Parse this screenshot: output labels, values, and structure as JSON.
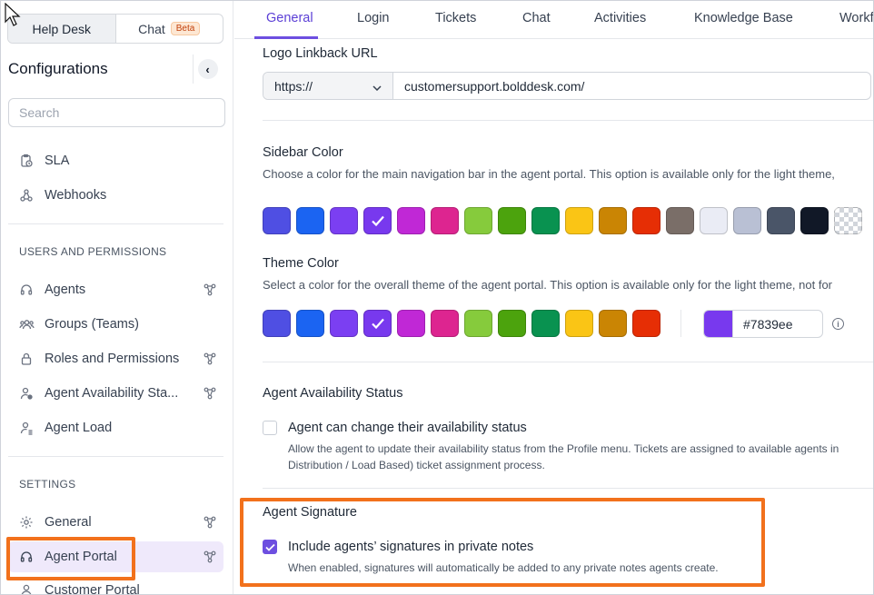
{
  "product_switch": {
    "helpdesk": "Help Desk",
    "chat": "Chat",
    "beta": "Beta"
  },
  "sidebar": {
    "title": "Configurations",
    "search_placeholder": "Search",
    "top_items": [
      {
        "label": "SLA",
        "icon": "clipboard-clock-icon"
      },
      {
        "label": "Webhooks",
        "icon": "webhook-icon"
      }
    ],
    "section_users": "USERS AND PERMISSIONS",
    "user_items": [
      {
        "label": "Agents",
        "icon": "headset-icon"
      },
      {
        "label": "Groups (Teams)",
        "icon": "users-icon"
      },
      {
        "label": "Roles and Permissions",
        "icon": "lock-icon"
      },
      {
        "label": "Agent Availability Sta...",
        "icon": "user-status-icon"
      },
      {
        "label": "Agent Load",
        "icon": "user-load-icon"
      }
    ],
    "section_settings": "SETTINGS",
    "settings_items": [
      {
        "label": "General",
        "icon": "gear-icon"
      },
      {
        "label": "Agent Portal",
        "icon": "headset-icon"
      },
      {
        "label": "Customer Portal",
        "icon": "user-icon"
      }
    ]
  },
  "tabs": [
    "General",
    "Login",
    "Tickets",
    "Chat",
    "Activities",
    "Knowledge Base",
    "Workf"
  ],
  "active_tab": "General",
  "logo_link": {
    "label": "Logo Linkback URL",
    "protocol": "https://",
    "url": "customersupport.bolddesk.com/"
  },
  "sidebar_color": {
    "label": "Sidebar Color",
    "description": "Choose a color for the main navigation bar in the agent portal. This option is available only for the light theme,",
    "swatches": [
      "#4f4fe3",
      "#1b64f2",
      "#7b3ff2",
      "#7839ee",
      "#c028d6",
      "#dd2590",
      "#86cb3c",
      "#4ca30d",
      "#099250",
      "#fac515",
      "#ca8504",
      "#e62e05",
      "#7a6e68",
      "#eaecf5",
      "#b9c0d4",
      "#4a5568",
      "#111827",
      "transparent"
    ],
    "selected": "#7839ee"
  },
  "theme_color": {
    "label": "Theme Color",
    "description": "Select a color for the overall theme of the agent portal. This option is available only for the light theme, not for",
    "swatches": [
      "#4f4fe3",
      "#1b64f2",
      "#7b3ff2",
      "#7839ee",
      "#c028d6",
      "#dd2590",
      "#86cb3c",
      "#4ca30d",
      "#099250",
      "#fac515",
      "#ca8504",
      "#e62e05"
    ],
    "selected": "#7839ee",
    "hex_value": "#7839ee"
  },
  "availability": {
    "label": "Agent Availability Status",
    "checkbox_label": "Agent can change their availability status",
    "checked": false,
    "desc_line1": "Allow the agent to update their availability status from the Profile menu. Tickets are assigned to available agents in",
    "desc_line2": "Distribution / Load Based) ticket assignment process."
  },
  "signature": {
    "label": "Agent Signature",
    "checkbox_label": "Include agents’ signatures in private notes",
    "checked": true,
    "desc": "When enabled, signatures will automatically be added to any private notes agents create."
  },
  "colors": {
    "accent": "#6d4fe0",
    "highlight": "#f2711c",
    "active_bg": "#efe9fb"
  }
}
